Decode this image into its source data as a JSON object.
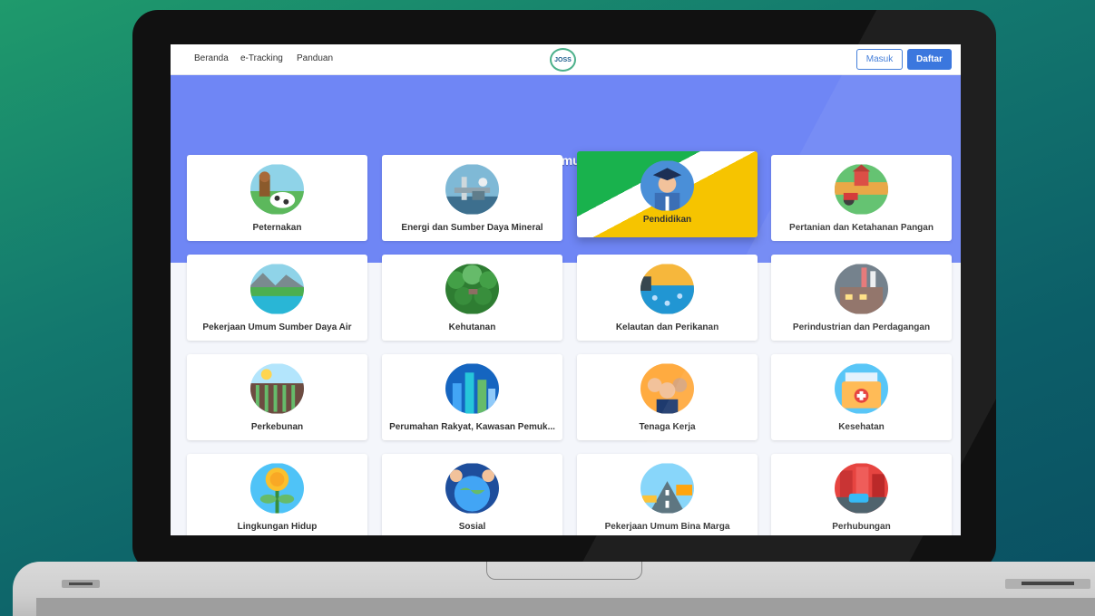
{
  "nav": {
    "links": [
      "Beranda",
      "e-Tracking",
      "Panduan"
    ],
    "logo_text": "JOSS",
    "login_label": "Masuk",
    "register_label": "Daftar"
  },
  "hero": {
    "title": "Jenis Perizinan Pada Jawa Timur Online Single Submission"
  },
  "categories": [
    {
      "label": "Peternakan",
      "icon": "livestock-icon"
    },
    {
      "label": "Energi dan Sumber Daya Mineral",
      "icon": "energy-icon"
    },
    {
      "label": "Pendidikan",
      "icon": "graduate-icon"
    },
    {
      "label": "Pertanian dan Ketahanan Pangan",
      "icon": "farm-icon"
    },
    {
      "label": "Pekerjaan Umum Sumber Daya Air",
      "icon": "water-resources-icon"
    },
    {
      "label": "Kehutanan",
      "icon": "forest-icon"
    },
    {
      "label": "Kelautan dan Perikanan",
      "icon": "marine-icon"
    },
    {
      "label": "Perindustrian dan Perdagangan",
      "icon": "factory-icon"
    },
    {
      "label": "Perkebunan",
      "icon": "plantation-icon"
    },
    {
      "label": "Perumahan Rakyat, Kawasan Pemuk...",
      "icon": "city-icon"
    },
    {
      "label": "Tenaga Kerja",
      "icon": "workers-icon"
    },
    {
      "label": "Kesehatan",
      "icon": "health-folder-icon"
    },
    {
      "label": "Lingkungan Hidup",
      "icon": "coin-plant-icon"
    },
    {
      "label": "Sosial",
      "icon": "social-globe-icon"
    },
    {
      "label": "Pekerjaan Umum Bina Marga",
      "icon": "road-construction-icon"
    },
    {
      "label": "Perhubungan",
      "icon": "transport-icon"
    }
  ]
}
